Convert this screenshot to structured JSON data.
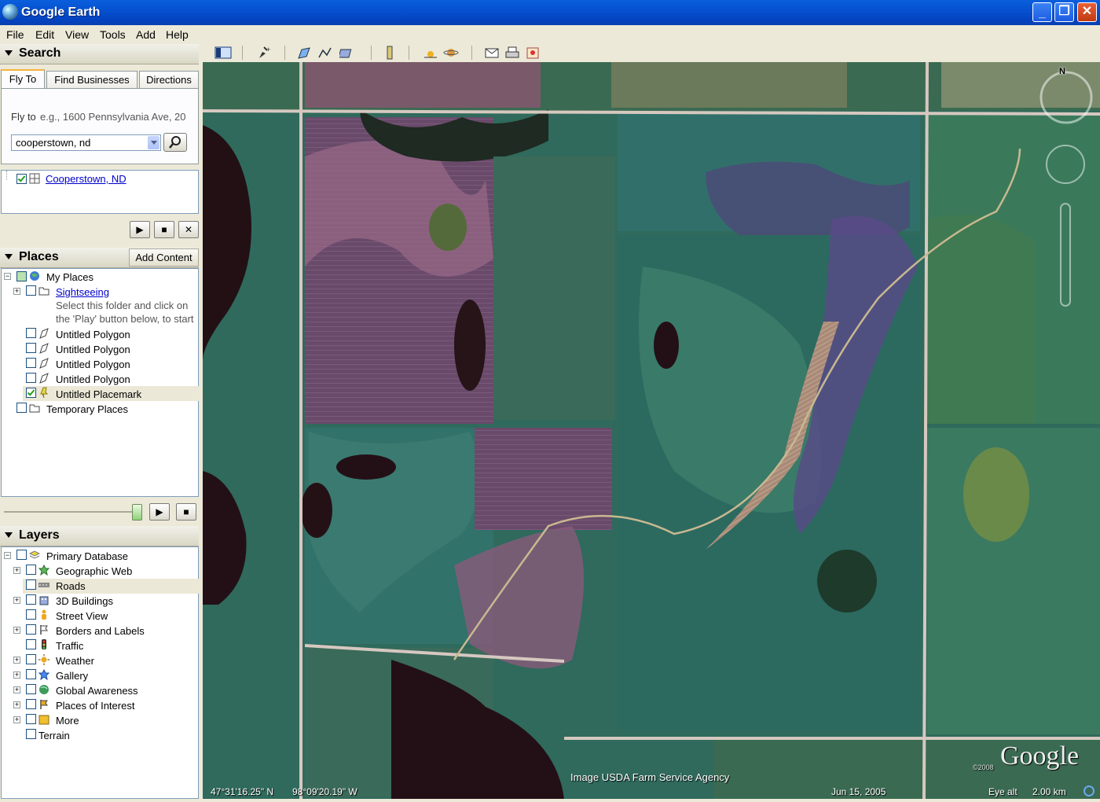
{
  "window": {
    "title": "Google Earth"
  },
  "menus": [
    "File",
    "Edit",
    "View",
    "Tools",
    "Add",
    "Help"
  ],
  "search": {
    "header": "Search",
    "tabs": [
      "Fly To",
      "Find Businesses",
      "Directions"
    ],
    "fly_to_label": "Fly to",
    "fly_to_hint": "e.g., 1600 Pennsylvania Ave, 20",
    "query": "cooperstown, nd",
    "result": "Cooperstown, ND"
  },
  "places": {
    "header": "Places",
    "add_content": "Add Content",
    "items": {
      "my_places": "My Places",
      "sightseeing": "Sightseeing",
      "sightseeing_desc1": "Select this folder and click on",
      "sightseeing_desc2": "the 'Play' button below, to start",
      "polygon1": "Untitled Polygon",
      "polygon2": "Untitled Polygon",
      "polygon3": "Untitled Polygon",
      "polygon4": "Untitled Polygon",
      "placemark": "Untitled Placemark",
      "temporary": "Temporary Places"
    }
  },
  "layers": {
    "header": "Layers",
    "items": {
      "primary": "Primary Database",
      "geo_web": "Geographic Web",
      "roads": "Roads",
      "buildings": "3D Buildings",
      "street_view": "Street View",
      "borders": "Borders and Labels",
      "traffic": "Traffic",
      "weather": "Weather",
      "gallery": "Gallery",
      "global": "Global Awareness",
      "poi": "Places of Interest",
      "more": "More",
      "terrain": "Terrain"
    }
  },
  "map": {
    "north": "N",
    "credit": "Image USDA Farm Service Agency",
    "lat": "47°31'16.25\" N",
    "lon": "98°09'20.19\" W",
    "date": "Jun 15, 2005",
    "eye_alt_label": "Eye alt",
    "eye_alt": "2.00 km",
    "copyright": "©2008",
    "logo": "Google"
  },
  "colors": {
    "title_bar": "#0651d0",
    "panel_bg": "#ece9d8",
    "link": "#0000cc"
  },
  "icons": [
    "globe-icon",
    "search-icon",
    "folder-icon",
    "polygon-icon",
    "placemark-icon",
    "play-icon",
    "stop-icon",
    "close-icon",
    "layers-icon",
    "star-icon",
    "road-icon",
    "building-icon",
    "person-icon",
    "flag-icon",
    "traffic-icon",
    "sun-icon",
    "compass-icon"
  ]
}
